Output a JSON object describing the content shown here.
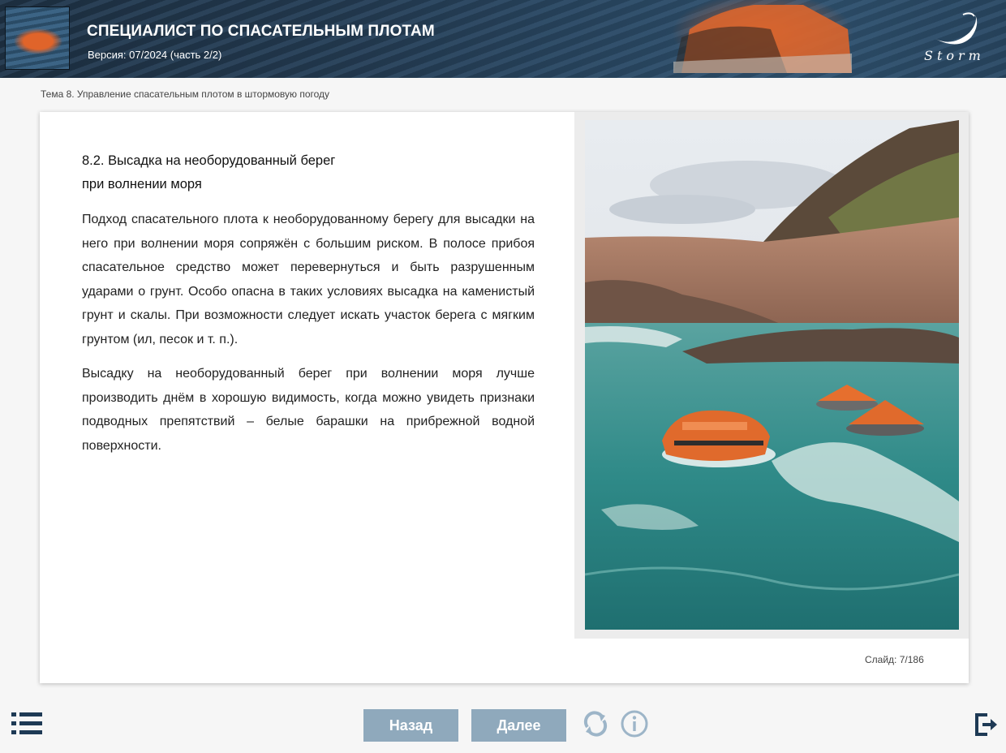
{
  "header": {
    "title": "СПЕЦИАЛИСТ ПО СПАСАТЕЛЬНЫМ ПЛОТАМ",
    "version": "Версия: 07/2024 (часть 2/2)",
    "logo_text": "Storm"
  },
  "breadcrumb": "Тема 8. Управление спасательным плотом в штормовую погоду",
  "slide": {
    "title_line1": "8.2. Высадка на необорудованный берег",
    "title_line2": "при волнении моря",
    "paragraphs": [
      "Подход спасательного плота к необорудованному берегу для высадки на него при волнении моря сопряжён с большим риском. В полосе прибоя спасательное средство может перевернуться и быть разрушенным ударами о грунт. Особо опасна в таких условиях высадка на каменистый грунт и скалы. При возможности следует искать участок берега с мягким грунтом (ил, песок и т. п.).",
      "Высадку на необорудованный берег при волнении моря лучше производить днём в хорошую видимость, когда можно увидеть признаки подводных препятствий – белые барашки на прибрежной водной поверхности."
    ],
    "counter": "Слайд: 7/186"
  },
  "nav": {
    "back_label": "Назад",
    "next_label": "Далее"
  },
  "icons": {
    "menu": "list-menu-icon",
    "reload": "reload-icon",
    "info": "info-icon",
    "exit": "exit-icon"
  },
  "colors": {
    "button": "#8fa9bc",
    "icon_dark": "#1e3a55",
    "icon_light": "#9db5c8",
    "raft": "#e0642a"
  }
}
